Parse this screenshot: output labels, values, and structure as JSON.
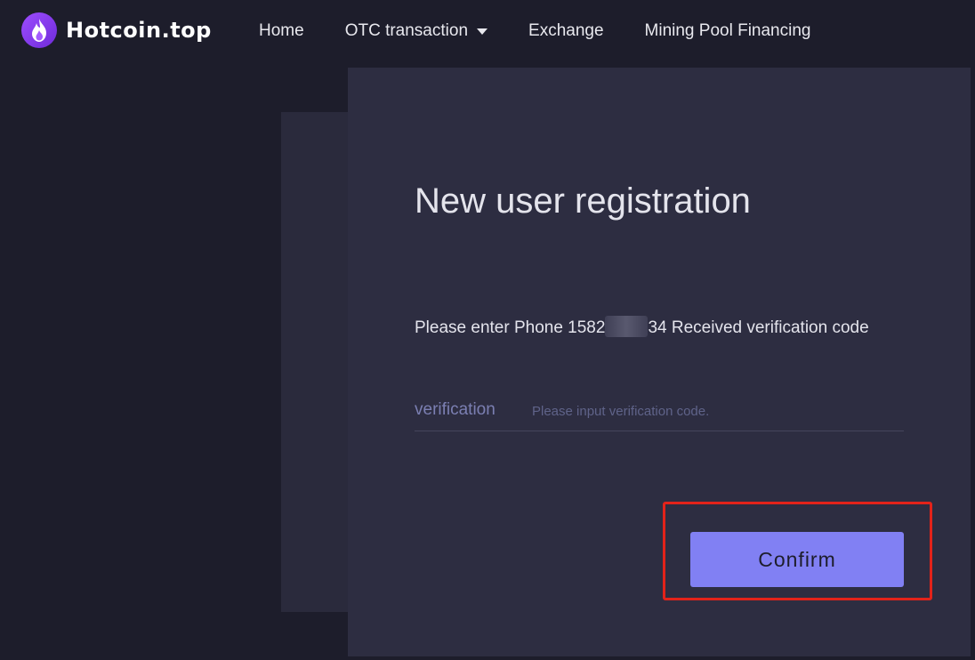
{
  "brand": {
    "name": "Hotcoin.top",
    "logo_icon": "flame-icon",
    "accent": "#8180f3"
  },
  "nav": {
    "items": [
      {
        "label": "Home"
      },
      {
        "label": "OTC transaction",
        "has_dropdown": true
      },
      {
        "label": "Exchange"
      },
      {
        "label": "Mining Pool Financing"
      }
    ]
  },
  "registration": {
    "title": "New user registration",
    "instruction_prefix": "Please enter Phone 1582",
    "instruction_suffix": "34 Received verification code",
    "field_label": "verification",
    "field_placeholder": "Please input verification code.",
    "field_value": "",
    "confirm_label": "Confirm"
  },
  "colors": {
    "background": "#1d1d2b",
    "card": "#2d2d41",
    "highlight": "#e2231a"
  }
}
